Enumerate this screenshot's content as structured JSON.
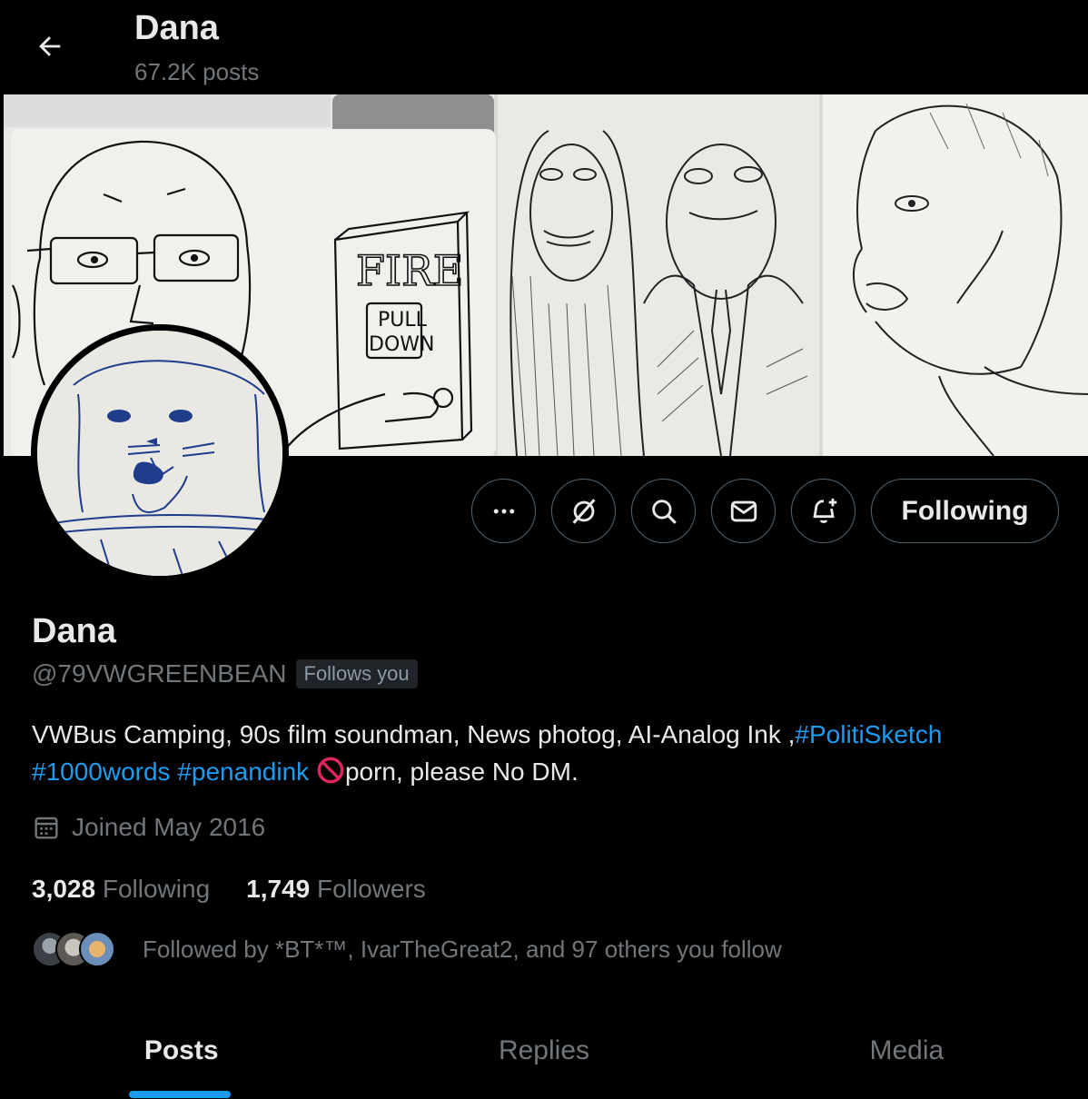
{
  "header": {
    "title": "Dana",
    "posts_count": "67.2K posts"
  },
  "banner": {
    "sign_text_top": "FIRE",
    "sign_text_mid": "PULL",
    "sign_text_bottom": "DOWN"
  },
  "actions": {
    "more_icon": "more-dots-icon",
    "grok_icon": "grok-icon",
    "search_icon": "search-icon",
    "message_icon": "envelope-icon",
    "notify_icon": "bell-plus-icon",
    "following_label": "Following"
  },
  "profile": {
    "name": "Dana",
    "handle": "@79VWGREENBEAN",
    "follows_you": "Follows you",
    "bio_text_1": "VWBus Camping, 90s film soundman, News photog, AI-Analog Ink ,",
    "bio_tag_1": "#PolitiSketch",
    "bio_tag_2": "#1000words",
    "bio_tag_3": "#penandink",
    "bio_text_2": "porn, please No DM.",
    "joined": "Joined May 2016",
    "following_count": "3,028",
    "following_label": "Following",
    "followers_count": "1,749",
    "followers_label": "Followers",
    "followed_by": "Followed by *BT*™, IvarTheGreat2, and 97 others you follow"
  },
  "tabs": [
    {
      "label": "Posts",
      "active": true
    },
    {
      "label": "Replies",
      "active": false
    },
    {
      "label": "Media",
      "active": false
    }
  ],
  "colors": {
    "accent": "#1d9bf0",
    "background": "#000000",
    "muted": "#71767b",
    "border": "#536471",
    "no_entry": "#e0245e"
  }
}
